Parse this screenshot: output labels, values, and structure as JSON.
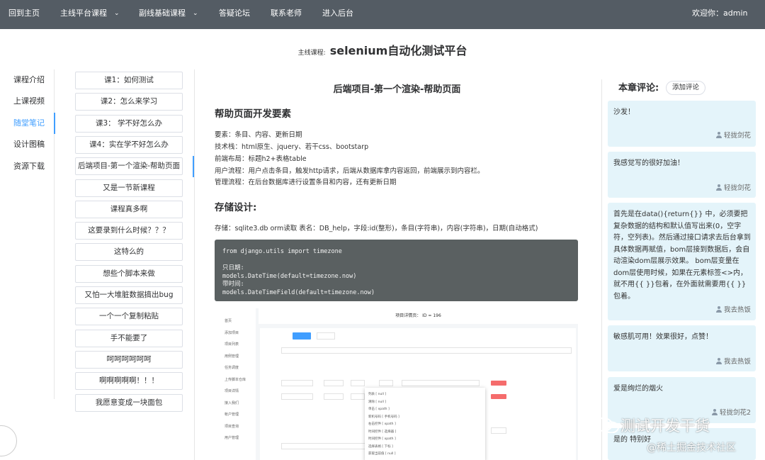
{
  "nav": {
    "items": [
      {
        "label": "回到主页",
        "dropdown": false
      },
      {
        "label": "主线平台课程",
        "dropdown": true
      },
      {
        "label": "副线基础课程",
        "dropdown": true
      },
      {
        "label": "答疑论坛",
        "dropdown": false
      },
      {
        "label": "联系老师",
        "dropdown": false
      },
      {
        "label": "进入后台",
        "dropdown": false
      }
    ],
    "welcome": "欢迎你：admin",
    "bg_color": "#545c64"
  },
  "course": {
    "label": "主线课程:",
    "name": "selenium自动化测试平台"
  },
  "sidebar": {
    "items": [
      {
        "label": "课程介绍",
        "active": false
      },
      {
        "label": "上课视频",
        "active": false
      },
      {
        "label": "随堂笔记",
        "active": true
      },
      {
        "label": "设计图稿",
        "active": false
      },
      {
        "label": "资源下载",
        "active": false
      }
    ],
    "active_color": "#409eff"
  },
  "lessons": [
    "课1：如何测试",
    "课2：怎么来学习",
    "课3：  学不好怎么办",
    "课4：实在学不好怎么办",
    "后端项目-第一个渲染-帮助页面",
    "又是一节新课程",
    "课程真多啊",
    "这要录到什么时候？？？",
    "这特么的",
    "想些个脚本来做",
    "又怕一大堆脏数据搞出bug",
    "一个一个复制粘贴",
    "手不能要了",
    "呵呵呵呵呵呵",
    "啊啊啊啊啊！！！",
    "我愿意变成一块面包"
  ],
  "content": {
    "heading": "后端项目-第一个渲染-帮助页面",
    "section1_title": "帮助页面开发要素",
    "section1_lines": [
      "要素：条目、内容、更新日期",
      "技术栈：html原生、jquery、若干css、bootstarp",
      "前端布局：标题h2+表格table",
      "用户流程：用户点击条目，触发http请求，后端从数据库拿内容返回，前端展示到内容栏。",
      "管理流程：在后台数据库进行设置条目和内容，还有更新日期"
    ],
    "section2_title": "存储设计:",
    "storage_line": "存储：sqlite3.db  orm读取  表名：DB_help，字段:id(整形)，条目(字符串)，内容(字符串)，日期(自动格式)",
    "code_lines": [
      "from django.utils import timezone",
      "",
      "只日期:",
      "models.DateTime(default=timezone.now)",
      "带时间:",
      "models.DateTimeField(default=timezone.now)"
    ]
  },
  "screenshot": {
    "header": "项目详情页：  ID = 196",
    "sidebar_items": [
      "首页",
      "添加项目",
      "项目列表",
      "用例管理",
      "任务调度",
      "上传脚本仓库",
      "项目详情",
      "接入我们",
      "帐户管理",
      "项目查询",
      "用户管理"
    ],
    "dropdown_items": [
      "列表 [ null ]",
      "清除 [ null ]",
      "单击 [ xpath ]",
      "新机号码 [ 手机号码 ]",
      "右击控件 [ xpath ]",
      "时间控件 [ 选择器 ]",
      "时间控件 [ xpath ]",
      "选择表格 [ 下标 ]",
      "获取当前值 [ null ]"
    ]
  },
  "comments": {
    "title": "本章评论:",
    "add_label": "添加评论",
    "items": [
      {
        "text": "沙发！",
        "author": "轻拢剑花"
      },
      {
        "text": "我感觉写的很好加油！",
        "author": "轻拢剑花"
      },
      {
        "text": "首先是在data(){return{}} 中，必须要把复杂数据的结构和默认值写出来(0，空字符，空列表)。然后通过接口请求去后台拿到具体数据再赋值，bom层接到数据后，会自动渲染dom层展示效果。 bom层变量在dom层使用时候，如果在元素标签<>内，就不用{{ }}包着，在外面就需要用{{ }} 包着。",
        "author": "我去热饭"
      },
      {
        "text": "敏感肌可用！效果很好，点赞！",
        "author": "我去热饭"
      },
      {
        "text": "爱是绚烂的烟火",
        "author": "轻拢剑花2"
      },
      {
        "text": "是的 特别好",
        "author": ""
      }
    ],
    "bg_color": "#e4f4fa"
  },
  "watermark": {
    "line1": "测试开发干货",
    "line2": "@稀土掘金技术社区"
  }
}
